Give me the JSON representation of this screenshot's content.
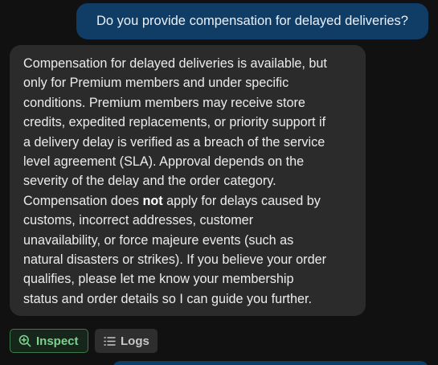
{
  "user_message": {
    "text": "Do you provide compensation for delayed deliveries?"
  },
  "assistant_message": {
    "lines": [
      [
        "Compensation for delayed deliveries is available, but"
      ],
      [
        "only for Premium members and under specific"
      ],
      [
        "conditions. Premium members may receive store"
      ],
      [
        "credits, expedited replacements, or priority support if"
      ],
      [
        "a delivery delay is verified as a breach of the service"
      ],
      [
        "level agreement (SLA). Approval depends on the"
      ],
      [
        "severity of the delay and the order category."
      ],
      [
        "Compensation does ",
        "not",
        " apply for delays caused by"
      ],
      [
        "customs, incorrect addresses, customer"
      ],
      [
        "unavailability, or force majeure events (such as"
      ],
      [
        "natural disasters or strikes). If you believe your order"
      ],
      [
        "qualifies, please let me know your membership"
      ],
      [
        "status and order details so I can guide you further."
      ]
    ]
  },
  "actions": {
    "inspect_label": "Inspect",
    "inspect_icon": "zoom-in-icon",
    "logs_label": "Logs",
    "logs_icon": "list-icon"
  },
  "colors": {
    "background": "#111111",
    "user_bubble": "#0f3d66",
    "assistant_bubble": "#2b2b2b",
    "inspect_accent": "#7ed08f"
  }
}
